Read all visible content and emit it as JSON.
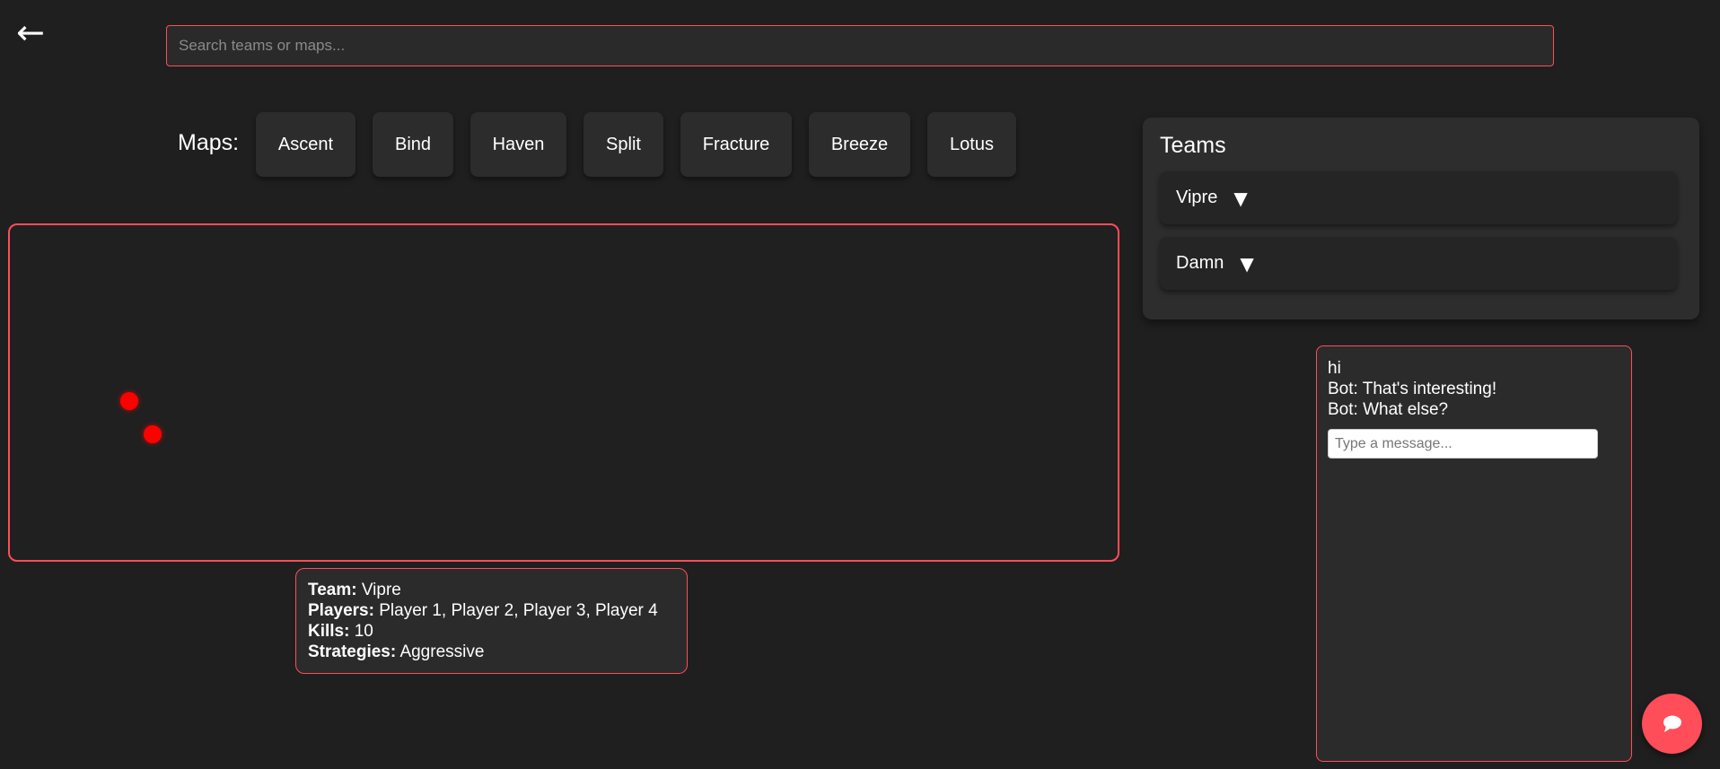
{
  "nav": {
    "back_glyph": "←",
    "back_icon": "back-arrow-icon"
  },
  "search": {
    "placeholder": "Search teams or maps...",
    "value": ""
  },
  "maps": {
    "label": "Maps:",
    "items": [
      "Ascent",
      "Bind",
      "Haven",
      "Split",
      "Fracture",
      "Breeze",
      "Lotus"
    ]
  },
  "info": {
    "team_label": "Team:",
    "team": "Vipre",
    "players_label": "Players:",
    "players": "Player 1, Player 2, Player 3, Player 4",
    "kills_label": "Kills:",
    "kills": "10",
    "strategies_label": "Strategies:",
    "strategies": "Aggressive"
  },
  "teams": {
    "title": "Teams",
    "items": [
      {
        "name": "Vipre",
        "caret": "▼"
      },
      {
        "name": "Damn",
        "caret": "▼"
      }
    ]
  },
  "chat": {
    "messages": [
      "hi",
      "Bot: That's interesting!",
      "Bot: What else?"
    ],
    "input_placeholder": "Type a message...",
    "fab_icon": "chat-bubble-icon"
  },
  "colors": {
    "background": "#1f1f1f",
    "accent": "#ff4d5a",
    "marker": "#ff0000",
    "panel": "#2d2d2d"
  }
}
